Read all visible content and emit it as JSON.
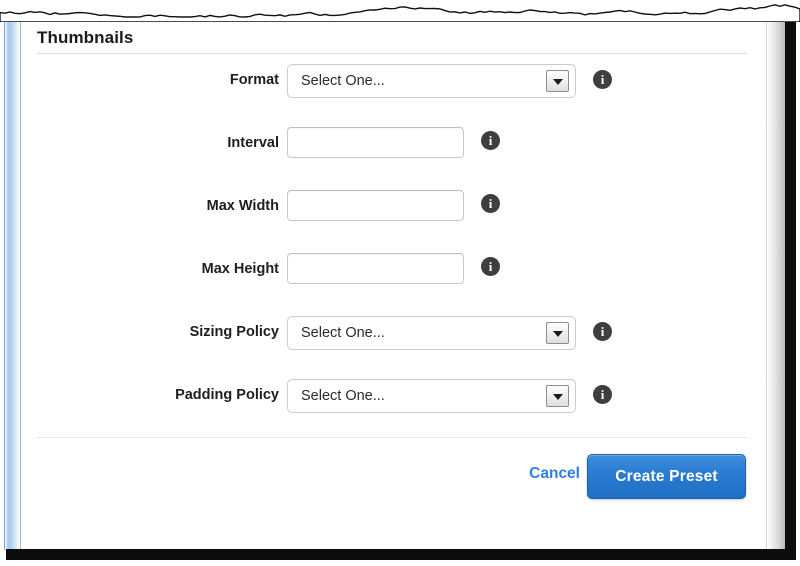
{
  "section": {
    "title": "Thumbnails"
  },
  "form": {
    "rows": [
      {
        "label": "Format",
        "kind": "select",
        "value": "Select One...",
        "info_icon": "info-icon",
        "caret_icon": "chevron-down-icon"
      },
      {
        "label": "Interval",
        "kind": "input",
        "value": "",
        "placeholder": "",
        "info_icon": "info-icon"
      },
      {
        "label": "Max Width",
        "kind": "input",
        "value": "",
        "placeholder": "",
        "info_icon": "info-icon"
      },
      {
        "label": "Max Height",
        "kind": "input",
        "value": "",
        "placeholder": "",
        "info_icon": "info-icon"
      },
      {
        "label": "Sizing Policy",
        "kind": "select",
        "value": "Select One...",
        "info_icon": "info-icon",
        "caret_icon": "chevron-down-icon"
      },
      {
        "label": "Padding Policy",
        "kind": "select",
        "value": "Select One...",
        "info_icon": "info-icon",
        "caret_icon": "chevron-down-icon"
      }
    ],
    "info_glyph": "i"
  },
  "footer": {
    "cancel_label": "Cancel",
    "submit_label": "Create Preset"
  },
  "chrome": {
    "left_scroll_strip": "left-scroll-strip",
    "right_scroll_strip": "right-scroll-strip",
    "torn_top_edge": "torn-top-edge"
  },
  "colors": {
    "primary_button": "#2a7ad1",
    "link": "#2d7fe8",
    "info_icon": "#3e3e3e",
    "text": "#1e1e1e",
    "divider": "#e0e0e0",
    "left_strip": "#a9c9ea",
    "right_strip": "#cfcfcf"
  }
}
